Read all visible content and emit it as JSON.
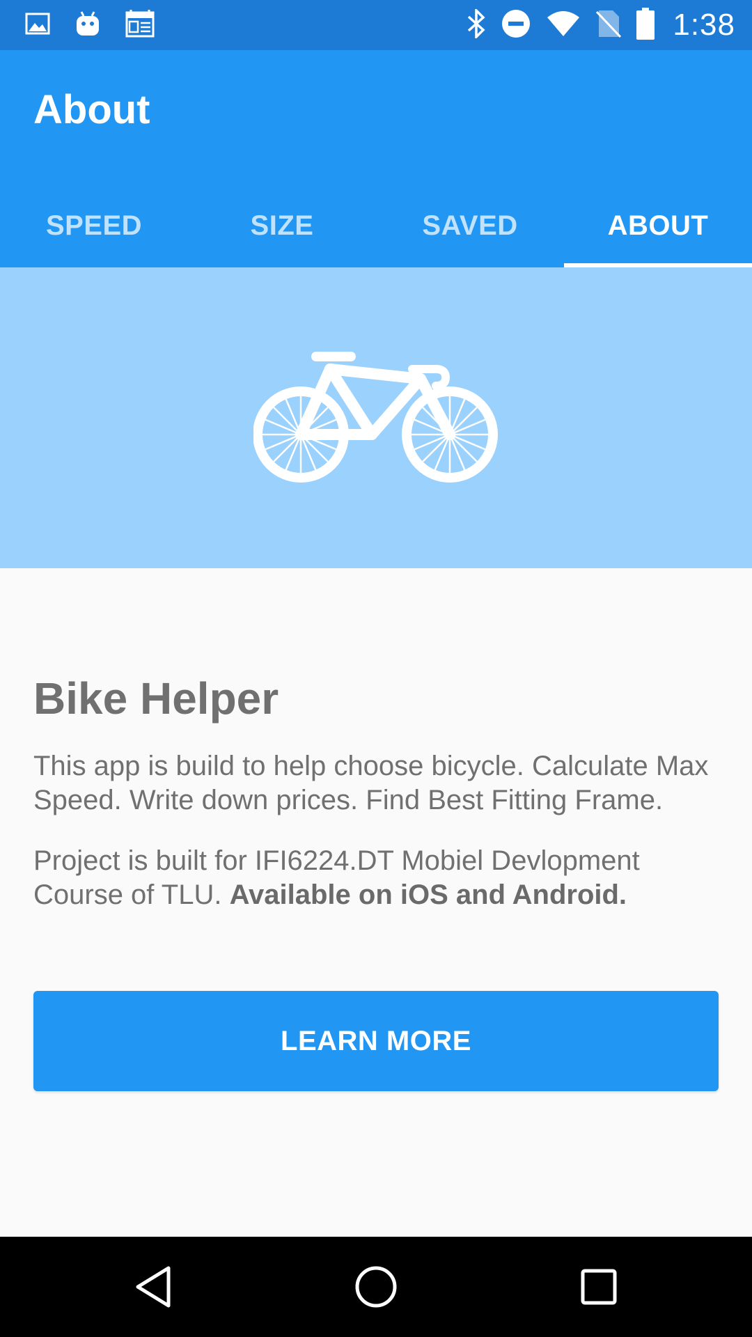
{
  "status_bar": {
    "time": "1:38",
    "left_icons": [
      "image-icon",
      "android-icon",
      "calendar-icon"
    ],
    "right_icons": [
      "bluetooth-icon",
      "do-not-disturb-icon",
      "wifi-icon",
      "no-sim-icon",
      "battery-icon"
    ]
  },
  "header": {
    "title": "About"
  },
  "tabs": [
    {
      "label": "SPEED",
      "active": false
    },
    {
      "label": "SIZE",
      "active": false
    },
    {
      "label": "SAVED",
      "active": false
    },
    {
      "label": "ABOUT",
      "active": true
    }
  ],
  "hero": {
    "icon": "bicycle-icon",
    "background": "#9bd1fd"
  },
  "content": {
    "title": "Bike Helper",
    "paragraph1": "This app is build to help choose bicycle. Calculate Max Speed. Write down prices. Find Best Fitting Frame.",
    "paragraph2_text": "Project is built for IFI6224.DT Mobiel Devlopment Course of TLU. ",
    "paragraph2_bold": "Available on iOS and Android."
  },
  "button": {
    "label": "LEARN MORE"
  },
  "nav_bar": {
    "buttons": [
      "back-icon",
      "home-icon",
      "recents-icon"
    ]
  },
  "colors": {
    "primary": "#2196f3",
    "status_bar": "#1e7bd5",
    "hero": "#9bd1fd",
    "text": "#707070"
  }
}
